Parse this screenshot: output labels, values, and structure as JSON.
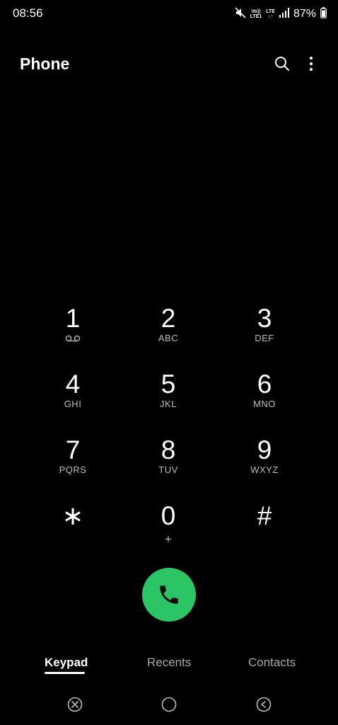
{
  "status_bar": {
    "time": "08:56",
    "volte_label_top": "Vo))",
    "volte_label_bottom": "LTE1",
    "lte_label_top": "LTE",
    "lte_label_bottom": "↓↑",
    "battery": "87%",
    "icons": [
      "mute-icon",
      "volte-icon",
      "lte-icon",
      "signal-icon",
      "battery-icon"
    ]
  },
  "header": {
    "title": "Phone",
    "icons": [
      "search-icon",
      "more-options-icon"
    ]
  },
  "keypad": {
    "keys": [
      {
        "digit": "1",
        "letters": "",
        "sub_icon": "voicemail-icon"
      },
      {
        "digit": "2",
        "letters": "ABC"
      },
      {
        "digit": "3",
        "letters": "DEF"
      },
      {
        "digit": "4",
        "letters": "GHI"
      },
      {
        "digit": "5",
        "letters": "JKL"
      },
      {
        "digit": "6",
        "letters": "MNO"
      },
      {
        "digit": "7",
        "letters": "PQRS"
      },
      {
        "digit": "8",
        "letters": "TUV"
      },
      {
        "digit": "9",
        "letters": "WXYZ"
      },
      {
        "digit": "∗",
        "letters": ""
      },
      {
        "digit": "0",
        "letters": "+"
      },
      {
        "digit": "#",
        "letters": ""
      }
    ]
  },
  "call_button": {
    "icon": "phone-icon",
    "color": "#2cc565"
  },
  "tabs": [
    {
      "label": "Keypad",
      "active": true
    },
    {
      "label": "Recents",
      "active": false
    },
    {
      "label": "Contacts",
      "active": false
    }
  ],
  "nav_bar": {
    "icons": [
      "recents-nav-icon",
      "home-nav-icon",
      "back-nav-icon"
    ]
  }
}
